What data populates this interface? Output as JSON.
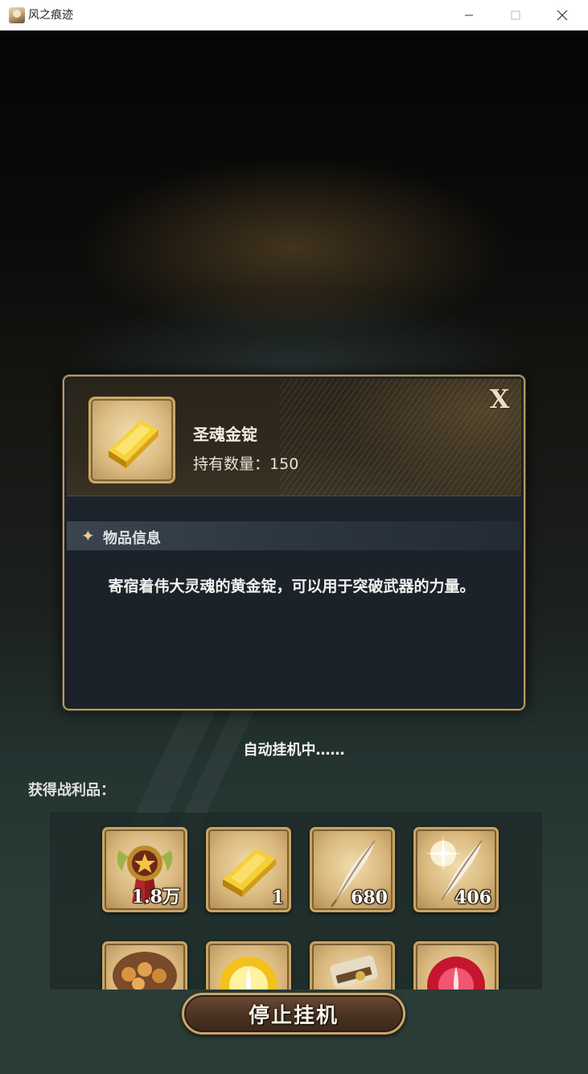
{
  "window": {
    "title": "风之痕迹",
    "icons": [
      "app-icon",
      "minimize-icon",
      "maximize-icon",
      "close-icon"
    ]
  },
  "dialog": {
    "item_name": "圣魂金锭",
    "count_label": "持有数量：",
    "count_value": "150",
    "section_title": "物品信息",
    "description": "寄宿着伟大灵魂的黄金锭，可以用于突破武器的力量。",
    "icons": [
      "gold-ingot-icon",
      "sparkle-icon",
      "close-icon"
    ]
  },
  "status": "自动挂机中……",
  "loot": {
    "label": "获得战利品：",
    "items": [
      {
        "icon": "medal-icon",
        "count": "1.8万"
      },
      {
        "icon": "gold-ingot-icon",
        "count": "1"
      },
      {
        "icon": "feather-icon",
        "count": "680"
      },
      {
        "icon": "shining-feather-icon",
        "count": "406"
      },
      {
        "icon": "cookie-pouch-icon",
        "count": ""
      },
      {
        "icon": "yellow-orb-icon",
        "count": ""
      },
      {
        "icon": "scroll-bundle-icon",
        "count": ""
      },
      {
        "icon": "red-orb-icon",
        "count": ""
      }
    ]
  },
  "stop_button": "停止挂机",
  "colors": {
    "accent_gold": "#c9a565",
    "panel_bg": "#1e242c",
    "button_bg": "#4c3323"
  }
}
